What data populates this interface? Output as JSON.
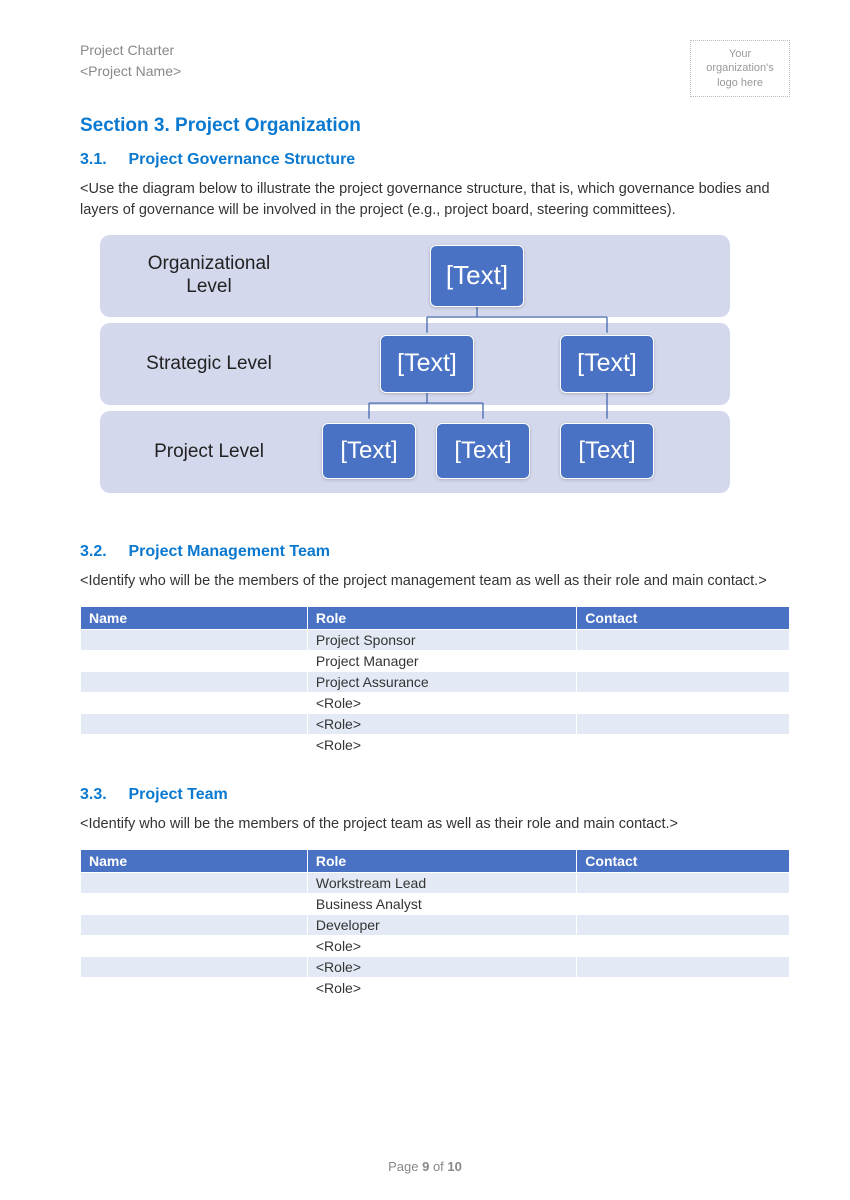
{
  "header": {
    "title_line1": "Project Charter",
    "title_line2": "<Project Name>",
    "logo_text": "Your organization's logo here"
  },
  "section": {
    "title": "Section 3. Project Organization"
  },
  "sub31": {
    "num": "3.1.",
    "title": "Project Governance Structure",
    "body": "<Use the diagram below to illustrate the project governance structure, that is, which governance bodies and layers of governance will be involved in the project (e.g., project board, steering committees)."
  },
  "orgchart": {
    "band1": "Organizational Level",
    "band2": "Strategic Level",
    "band3": "Project Level",
    "node_text": "[Text]"
  },
  "sub32": {
    "num": "3.2.",
    "title": "Project Management Team",
    "body": "<Identify who will be the members of the project management team as well as their role and main contact.>",
    "headers": {
      "name": "Name",
      "role": "Role",
      "contact": "Contact"
    },
    "rows": [
      {
        "name": "",
        "role": "Project Sponsor",
        "contact": ""
      },
      {
        "name": "",
        "role": "Project Manager",
        "contact": ""
      },
      {
        "name": "",
        "role": "Project Assurance",
        "contact": ""
      },
      {
        "name": "",
        "role": "<Role>",
        "contact": ""
      },
      {
        "name": "",
        "role": "<Role>",
        "contact": ""
      },
      {
        "name": "",
        "role": "<Role>",
        "contact": ""
      }
    ]
  },
  "sub33": {
    "num": "3.3.",
    "title": "Project Team",
    "body": "<Identify who will be the members of the project team as well as their role and main contact.>",
    "headers": {
      "name": "Name",
      "role": "Role",
      "contact": "Contact"
    },
    "rows": [
      {
        "name": "",
        "role": "Workstream Lead",
        "contact": ""
      },
      {
        "name": "",
        "role": "Business Analyst",
        "contact": ""
      },
      {
        "name": "",
        "role": "Developer",
        "contact": ""
      },
      {
        "name": "",
        "role": "<Role>",
        "contact": ""
      },
      {
        "name": "",
        "role": "<Role>",
        "contact": ""
      },
      {
        "name": "",
        "role": "<Role>",
        "contact": ""
      }
    ]
  },
  "footer": {
    "prefix": "Page ",
    "current": "9",
    "of": " of ",
    "total": "10"
  }
}
